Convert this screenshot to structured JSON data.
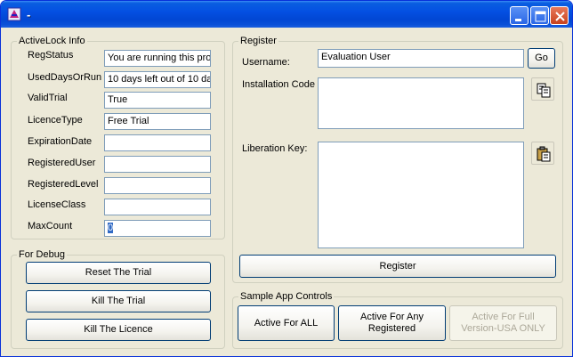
{
  "window": {
    "title": "-",
    "min_label": "minimize-button",
    "max_label": "maximize-button",
    "close_label": "close-button"
  },
  "info": {
    "legend": "ActiveLock Info",
    "fields": [
      {
        "label": "RegStatus",
        "value": "You are running this pro"
      },
      {
        "label": "UsedDaysOrRun",
        "value": "10 days left out of 10 da"
      },
      {
        "label": "ValidTrial",
        "value": "True"
      },
      {
        "label": "LicenceType",
        "value": "Free Trial"
      },
      {
        "label": "ExpirationDate",
        "value": ""
      },
      {
        "label": "RegisteredUser",
        "value": ""
      },
      {
        "label": "RegisteredLevel",
        "value": ""
      },
      {
        "label": "LicenseClass",
        "value": ""
      },
      {
        "label": "MaxCount",
        "value": "0"
      }
    ]
  },
  "debug": {
    "legend": "For Debug",
    "reset": "Reset The Trial",
    "kill_trial": "Kill The Trial",
    "kill_licence": "Kill The Licence"
  },
  "register": {
    "legend": "Register",
    "username_label": "Username:",
    "username_value": "Evaluation User",
    "go": "Go",
    "install_label": "Installation Code",
    "install_value": "",
    "liberation_label": "Liberation Key:",
    "liberation_value": "",
    "register_button": "Register"
  },
  "sample": {
    "legend": "Sample App Controls",
    "all": "Active For ALL",
    "any_registered": "Active For Any Registered",
    "full_version": "Active For Full Version-USA ONLY"
  }
}
